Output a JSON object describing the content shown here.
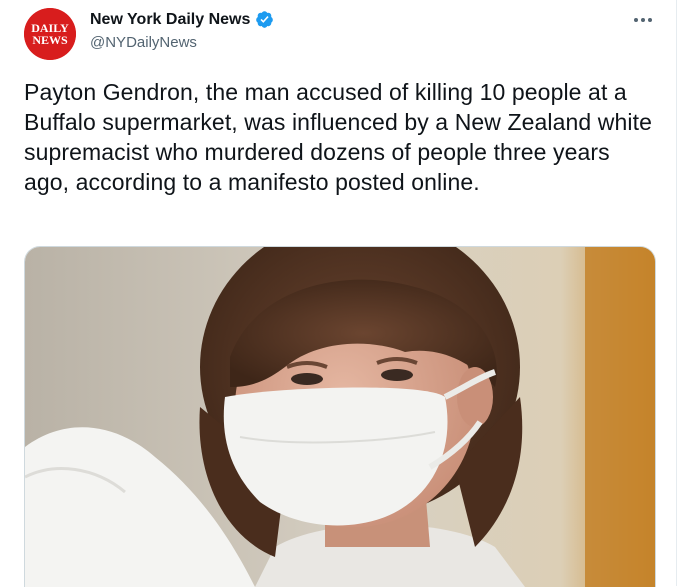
{
  "account": {
    "display_name": "New York Daily News",
    "handle": "@NYDailyNews",
    "avatar_text_line1": "DAILY",
    "avatar_text_line2": "NEWS",
    "verified": true
  },
  "tweet": {
    "text": "Payton Gendron, the man accused of killing 10 people at a Buffalo supermarket, was influenced by a New Zealand white supremacist who murdered dozens of people three years ago, according to a manifesto posted online."
  },
  "icons": {
    "more": "more-horizontal-icon",
    "verified": "verified-badge-icon"
  },
  "colors": {
    "brand_red": "#d81d1d",
    "verified_blue": "#1d9bf0",
    "secondary_text": "#536471"
  }
}
